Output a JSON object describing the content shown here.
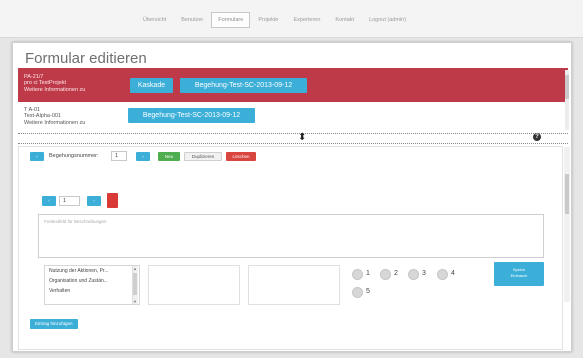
{
  "nav": {
    "items": [
      "Übersicht",
      "Benutzer",
      "Formulare",
      "Projekte",
      "Experteren",
      "Kontakt",
      "Logout (admin)"
    ],
    "active_index": 2
  },
  "page": {
    "title": "Formular editieren"
  },
  "red_row": {
    "line1": "PA-21/7",
    "line2": "pro ci TestProjekt",
    "line3": "Weitere Informationen zu",
    "kaskade_label": "Kaskade",
    "begehung_label": "Begehung-Test-SC-2013-09-12"
  },
  "white_row": {
    "line1": "T A-01",
    "line2": "Test-Alpha-001",
    "line3": "Weitere Informationen zu",
    "begehung_label": "Begehung-Test-SC-2013-09-12"
  },
  "toolbar": {
    "begehungsnummer_label": "Begehungsnummer:",
    "begehungsnummer_value": "1",
    "new_label": "Neu",
    "duplicate_label": "Duplizieren",
    "delete_label": "Löschen"
  },
  "stepper": {
    "value": "1"
  },
  "description": {
    "placeholder": "Freitextfeld für Beschreibungen"
  },
  "list": {
    "items": [
      "Nutzung der Aktionen, Pr...",
      "Organisation und Zustän...",
      "Verhalten"
    ]
  },
  "rating": {
    "options": [
      "1",
      "2",
      "3",
      "4",
      "5"
    ]
  },
  "save": {
    "line1": "Speich",
    "line2": "Eintrasch"
  },
  "footer": {
    "add_label": "Eintrag hinzufügen"
  },
  "colors": {
    "accent": "#3cafd9",
    "danger": "#bf3a49",
    "success": "#4fae4f"
  }
}
